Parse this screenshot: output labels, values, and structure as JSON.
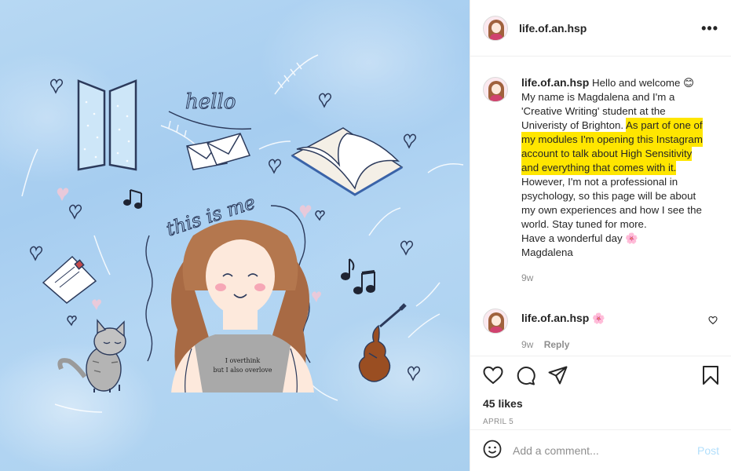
{
  "post": {
    "username": "life.of.an.hsp",
    "image_texts": {
      "hello": "hello",
      "this_is_me": "this is me",
      "shirt_line1": "I overthink",
      "shirt_line2": "but I also overlove"
    }
  },
  "caption": {
    "username": "life.of.an.hsp",
    "part1": "Hello and welcome 😊 My name is Magdalena and I'm a 'Creative Writing' student at the Univeristy of Brighton.",
    "highlighted": "As part of one of my modules I'm opening this Instagram account to talk about High Sensitivity and everything that comes with it.",
    "part2": "However, I'm not a professional in psychology, so this page will be about my own experiences and how I see the world. Stay tuned for more.",
    "line_sign1": "Have a wonderful day 🌸",
    "line_sign2": "Magdalena",
    "time": "9w"
  },
  "reply": {
    "username": "life.of.an.hsp",
    "text": "🌸",
    "time": "9w",
    "reply_label": "Reply"
  },
  "actions": {
    "likes": "45 likes",
    "date": "April 5"
  },
  "comment_box": {
    "placeholder": "Add a comment...",
    "post_label": "Post"
  },
  "colors": {
    "highlight": "#ffe600",
    "post_button": "#b2dffc",
    "muted": "#8e8e8e"
  }
}
